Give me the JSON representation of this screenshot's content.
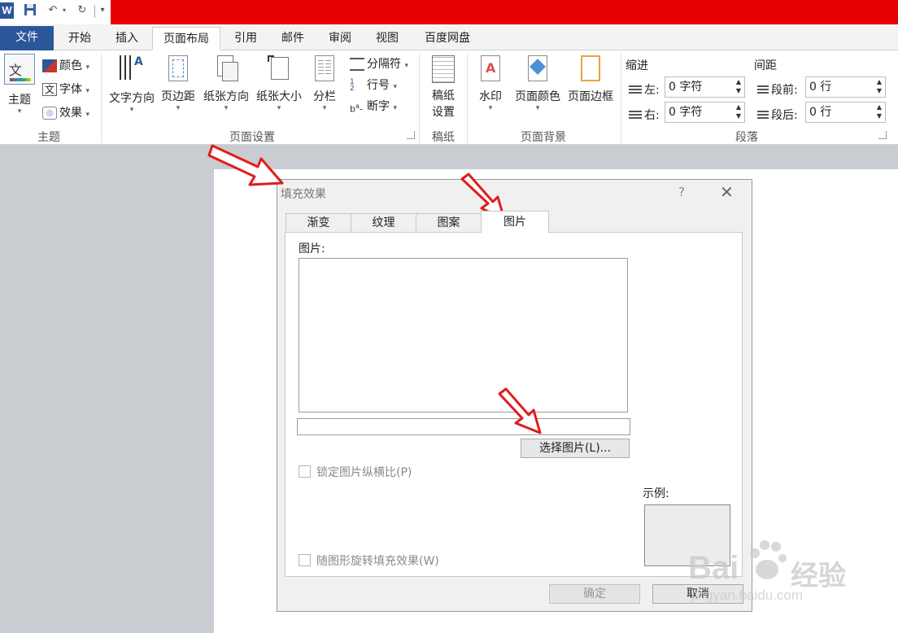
{
  "quick_access": {
    "app_logo": "W",
    "icons": [
      "save-icon",
      "undo-icon",
      "redo-icon",
      "customize-icon"
    ]
  },
  "tabs": [
    {
      "label": "文件"
    },
    {
      "label": "开始"
    },
    {
      "label": "插入"
    },
    {
      "label": "页面布局",
      "active": true
    },
    {
      "label": "引用"
    },
    {
      "label": "邮件"
    },
    {
      "label": "审阅"
    },
    {
      "label": "视图"
    },
    {
      "label": "百度网盘"
    }
  ],
  "ribbon": {
    "theme_group": {
      "label": "主题",
      "theme_button": "主题",
      "colors": "颜色",
      "fonts": "字体",
      "effects": "效果"
    },
    "page_setup_group": {
      "label": "页面设置",
      "text_direction": "文字方向",
      "margins": "页边距",
      "orientation": "纸张方向",
      "size": "纸张大小",
      "columns": "分栏",
      "breaks": "分隔符",
      "line_numbers": "行号",
      "hyphenation": "断字"
    },
    "manuscript_group": {
      "label": "稿纸",
      "button_line1": "稿纸",
      "button_line2": "设置"
    },
    "page_background_group": {
      "label": "页面背景",
      "watermark": "水印",
      "page_color": "页面颜色",
      "page_borders": "页面边框"
    },
    "paragraph_group": {
      "label": "段落",
      "indent_heading": "缩进",
      "spacing_heading": "间距",
      "indent_left_label": "左:",
      "indent_left_value": "0 字符",
      "indent_right_label": "右:",
      "indent_right_value": "0 字符",
      "spacing_before_label": "段前:",
      "spacing_before_value": "0 行",
      "spacing_after_label": "段后:",
      "spacing_after_value": "0 行"
    }
  },
  "dialog": {
    "title": "填充效果",
    "help": "?",
    "tabs": [
      {
        "label": "渐变"
      },
      {
        "label": "纹理"
      },
      {
        "label": "图案"
      },
      {
        "label": "图片",
        "active": true
      }
    ],
    "picture_label": "图片:",
    "path_value": "",
    "select_picture_button": "选择图片(L)...",
    "lock_aspect_label": "锁定图片纵横比(P)",
    "rotate_with_shape_label": "随图形旋转填充效果(W)",
    "sample_label": "示例:",
    "ok_button": "确定",
    "cancel_button": "取消"
  },
  "watermark": {
    "brand": "Bai",
    "brand_suffix": "经验",
    "url": "jingyan.baidu.com"
  },
  "colors": {
    "title_red": "#e60000",
    "file_tab_blue": "#2b579a",
    "annotation_red": "#e21c1c"
  }
}
